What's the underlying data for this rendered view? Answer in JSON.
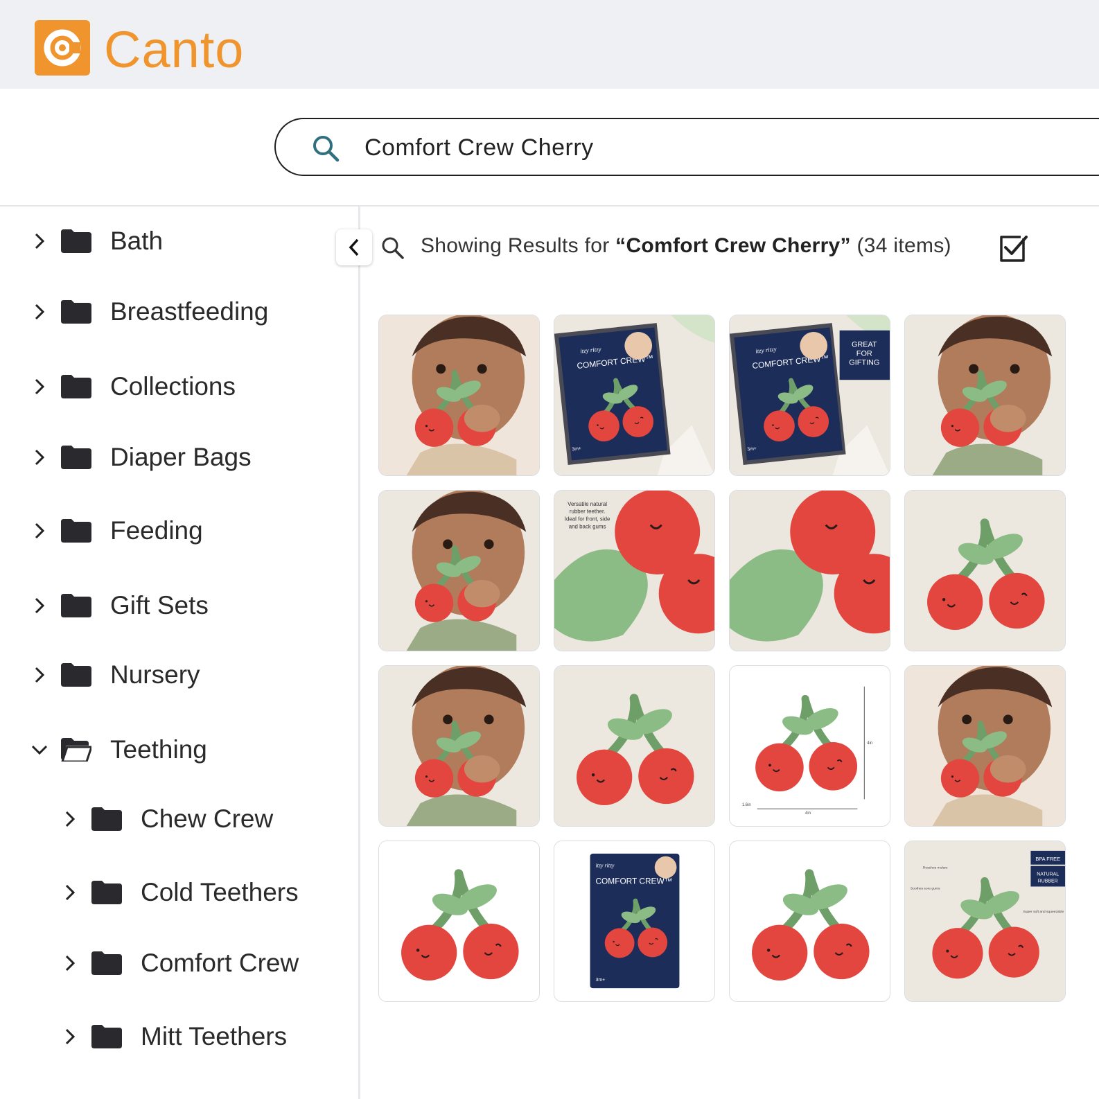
{
  "app": {
    "brand": "Canto",
    "accent": "#f0952e"
  },
  "search": {
    "value": "Comfort Crew Cherry",
    "icon": "search-icon"
  },
  "sidebar": {
    "items": [
      {
        "label": "Bath",
        "expanded": false,
        "level": 0
      },
      {
        "label": "Breastfeeding",
        "expanded": false,
        "level": 0
      },
      {
        "label": "Collections",
        "expanded": false,
        "level": 0
      },
      {
        "label": "Diaper Bags",
        "expanded": false,
        "level": 0
      },
      {
        "label": "Feeding",
        "expanded": false,
        "level": 0
      },
      {
        "label": "Gift Sets",
        "expanded": false,
        "level": 0
      },
      {
        "label": "Nursery",
        "expanded": false,
        "level": 0
      },
      {
        "label": "Teething",
        "expanded": true,
        "level": 0
      },
      {
        "label": "Chew Crew",
        "expanded": false,
        "level": 1
      },
      {
        "label": "Cold Teethers",
        "expanded": false,
        "level": 1
      },
      {
        "label": "Comfort Crew",
        "expanded": false,
        "level": 1
      },
      {
        "label": "Mitt Teethers",
        "expanded": false,
        "level": 1
      }
    ]
  },
  "results": {
    "prefix": "Showing Results for ",
    "query": "“Comfort Crew Cherry”",
    "count": "(34 items)"
  },
  "thumbnails": [
    {
      "type": "baby-closeup"
    },
    {
      "type": "package",
      "pkg_brand": "itzy ritzy",
      "pkg_title": "COMFORT CREW™",
      "pkg_age": "3m+"
    },
    {
      "type": "package-gift",
      "pkg_brand": "itzy ritzy",
      "pkg_title": "COMFORT CREW™",
      "pkg_age": "3m+",
      "badge": [
        "GREAT",
        "FOR",
        "GIFTING"
      ]
    },
    {
      "type": "baby-smile"
    },
    {
      "type": "baby-smile"
    },
    {
      "type": "closeup-text",
      "caption": [
        "Versatile natural",
        "rubber teether.",
        "Ideal for front, side",
        "and back gums"
      ]
    },
    {
      "type": "closeup"
    },
    {
      "type": "cherry-beige"
    },
    {
      "type": "baby-smile"
    },
    {
      "type": "cherry-beige"
    },
    {
      "type": "cherry-dims",
      "dims": [
        "4in",
        "1.6in",
        "4in"
      ]
    },
    {
      "type": "baby-closeup"
    },
    {
      "type": "cherry-white"
    },
    {
      "type": "package-solo",
      "pkg_brand": "itzy ritzy",
      "pkg_title": "COMFORT CREW™",
      "pkg_age": "3m+"
    },
    {
      "type": "cherry-white"
    },
    {
      "type": "cherry-infographic",
      "badges": [
        "BPA FREE",
        "NATURAL RUBBER"
      ],
      "notes": [
        "Reaches molars",
        "Soothes sore gums",
        "Super soft and squeezable"
      ]
    }
  ]
}
